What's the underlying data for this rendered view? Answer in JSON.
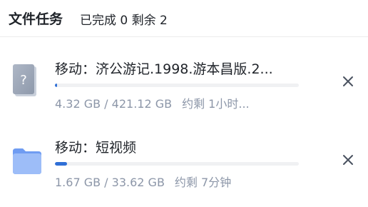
{
  "header": {
    "title": "文件任务",
    "summary": "已完成 0 剩余 2"
  },
  "tasks": [
    {
      "icon": "unknown-file-icon",
      "name": "移动：济公游记.1998.游本昌版.2...",
      "progress": 0.01,
      "size_text": "4.32 GB / 421.12 GB",
      "eta_text": "约剩 1小时..."
    },
    {
      "icon": "folder-icon",
      "name": "移动：短视频",
      "progress": 0.05,
      "size_text": "1.67 GB / 33.62 GB",
      "eta_text": "约剩 7分钟"
    }
  ],
  "colors": {
    "progress": "#2f6fd6",
    "track": "#f0f1f3",
    "meta_text": "#8c96a8",
    "folder": "#8fb3f7"
  },
  "icons": {
    "close": "close-icon"
  }
}
